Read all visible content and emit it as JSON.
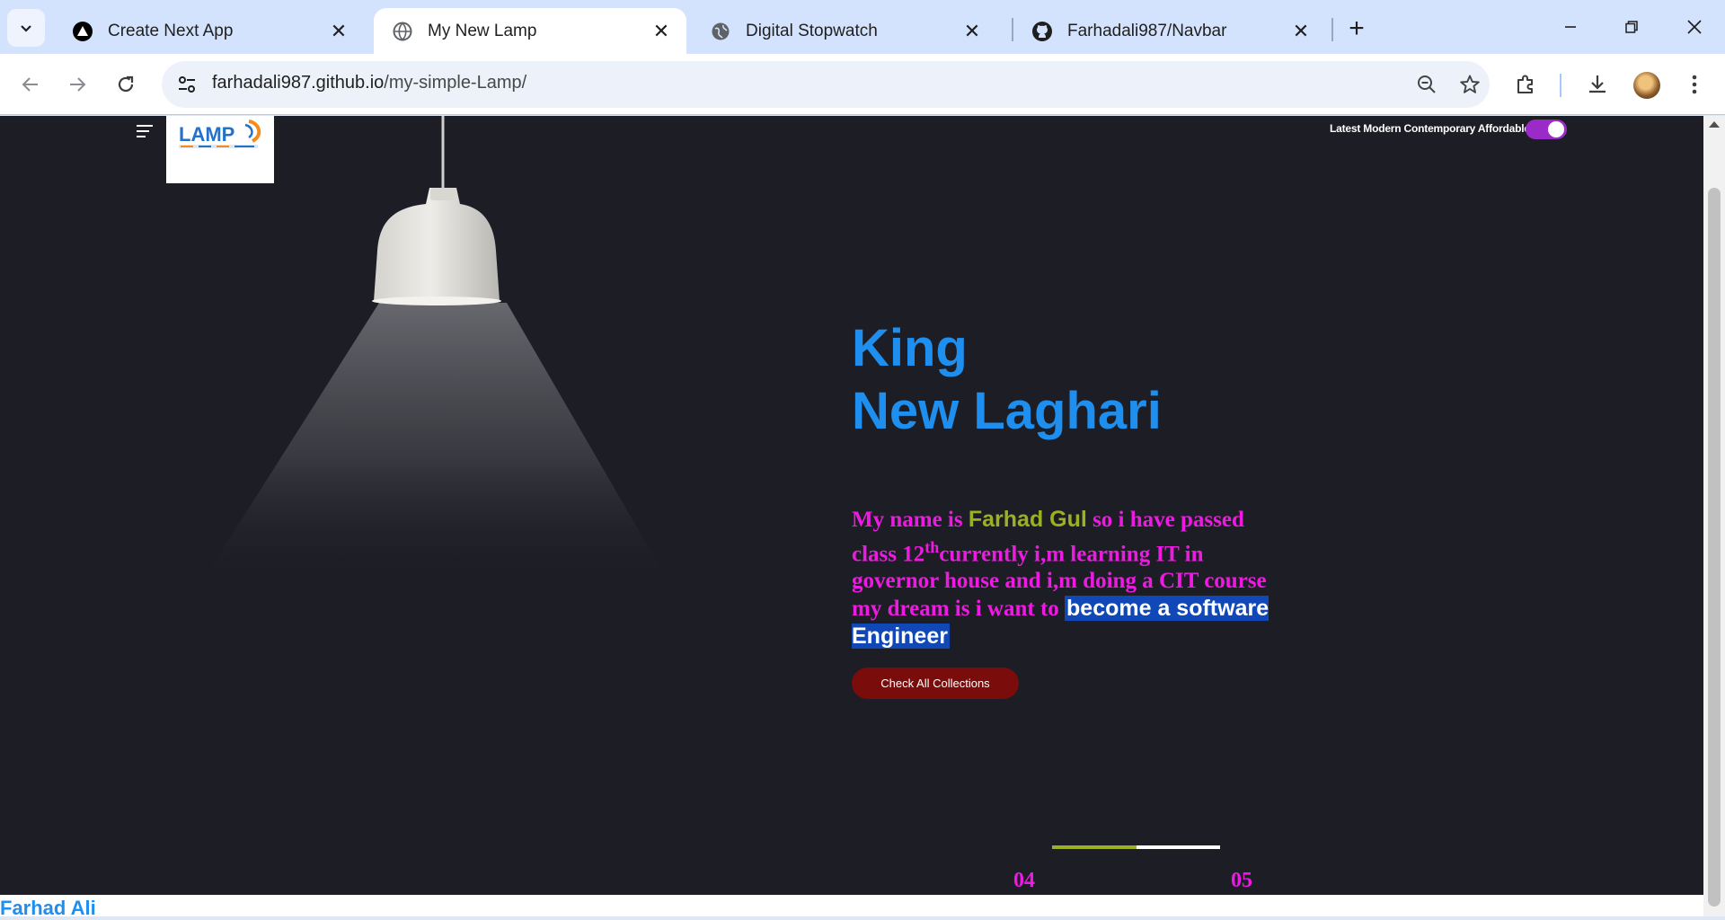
{
  "browser": {
    "tabs": [
      {
        "title": "Create Next App",
        "icon": "nextjs-icon"
      },
      {
        "title": "My New Lamp",
        "icon": "globe-icon",
        "active": true
      },
      {
        "title": "Digital Stopwatch",
        "icon": "globe-icon"
      },
      {
        "title": "Farhadali987/Navbar",
        "icon": "github-icon"
      }
    ],
    "url_host": "farhadali987.github.io",
    "url_path": "/my-simple-Lamp/"
  },
  "page": {
    "background": "#1d1e25",
    "header": {
      "toggle_label": "Latest Modern Contemporary Affordable",
      "toggle_on": true,
      "logo_text": "LAMP"
    },
    "hero": {
      "title_line1": "King",
      "title_line2": "New Laghari",
      "title_color": "#1e8fef"
    },
    "bio": {
      "part1": "My name is ",
      "name": "Farhad Gul",
      "part2": " so i have passed class 12",
      "superscript": "th",
      "part3": "currently i,m learning IT in governor house and i,m doing a CIT course my dream is i want to ",
      "highlight": "become a software Engineer",
      "text_color": "#ee1ae3",
      "name_color": "#9cb021",
      "highlight_bg": "#1048b8"
    },
    "cta_label": "Check All Collections",
    "pager": {
      "current": "04",
      "total": "05",
      "progress": 0.5
    },
    "footer_name": "Farhad Ali"
  }
}
